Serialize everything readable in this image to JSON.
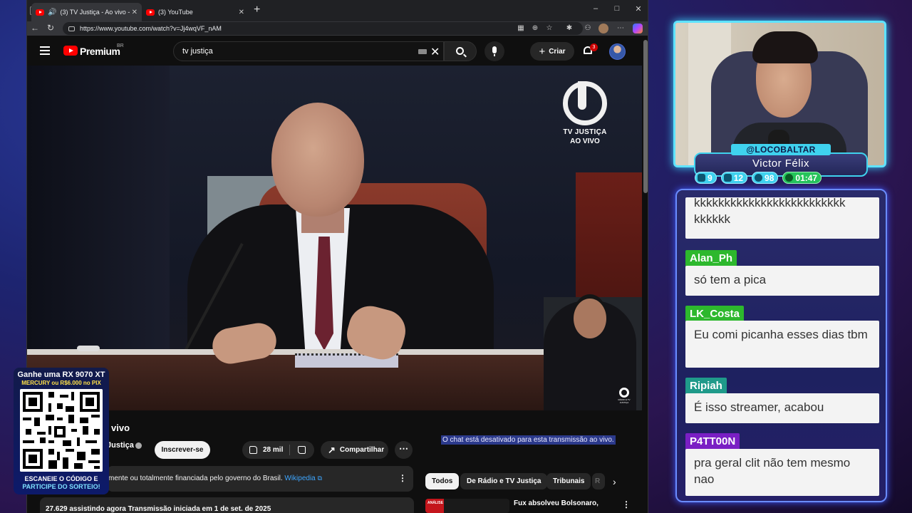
{
  "browser": {
    "tabs": [
      {
        "title": "(3) TV Justiça - Ao vivo - You",
        "active": true
      },
      {
        "title": "(3) YouTube",
        "active": false
      }
    ],
    "new_tab": "+",
    "window_controls": {
      "minimize": "–",
      "maximize": "□",
      "close": "✕"
    },
    "url": "https://www.youtube.com/watch?v=Jj4wqVF_nAM"
  },
  "youtube": {
    "brand": "Premium",
    "country": "BR",
    "search_query": "tv justiça",
    "create_label": "Criar",
    "notification_count": "3",
    "video_overlay": {
      "logo_line1": "TV JUSTIÇA",
      "logo_line2": "AO VIVO",
      "corner_logo": "RÁDIO E TV JUSTIÇA"
    },
    "video_title": "vivo",
    "channel_name": "Justiça",
    "subscribe_label": "Inscrever-se",
    "likes": "28 mil",
    "share_label": "Compartilhar",
    "info_text": "mente ou totalmente financiada pelo governo do Brasil.",
    "info_link": "Wikipedia",
    "description": "27.629 assistindo agora  Transmissão iniciada em 1 de set. de 2025",
    "chat_disabled": "O chat está desativado para esta transmissão ao vivo.",
    "chips": [
      "Todos",
      "De Rádio e TV Justiça",
      "Tribunais",
      "R"
    ],
    "recommendation": {
      "badge": "ANÁLISE",
      "title": "Fux absolveu Bolsonaro,"
    }
  },
  "promo": {
    "line1": "Ganhe uma RX 9070 XT",
    "line2": "MERCURY ou R$6.000 no PIX",
    "line3": "ESCANEIE O CÓDIGO E",
    "line4": "PARTICIPE DO SORTEIO!"
  },
  "streamer": {
    "handle": "@LOCOBALTAR",
    "name": "Victor  Félix",
    "stats": [
      {
        "icon": "chat-icon",
        "value": "9"
      },
      {
        "icon": "youtube-icon",
        "value": "12"
      },
      {
        "icon": "link-icon",
        "value": "98"
      },
      {
        "icon": "whatsapp-icon",
        "value": "01:47"
      }
    ]
  },
  "chat": {
    "messages": [
      {
        "user": "",
        "text": "kkkkkkkkkkkkkkkkkkkkkkkkk kkkkkk",
        "color": ""
      },
      {
        "user": "Alan_Ph",
        "text": "só tem a pica",
        "color": "#2db82d"
      },
      {
        "user": "LK_Costa",
        "text": "Eu comi picanha esses dias tbm",
        "color": "#2db82d"
      },
      {
        "user": "Ripiah",
        "text": "É isso streamer, acabou",
        "color": "#1f9a8a"
      },
      {
        "user": "P4TT00N",
        "text": "pra geral clit não tem mesmo nao",
        "color": "#7a1fc4"
      }
    ]
  },
  "colors": {
    "accent_cyan": "#3fd2ee",
    "youtube_red": "#ff0000",
    "chat_border": "#6a8cff"
  }
}
